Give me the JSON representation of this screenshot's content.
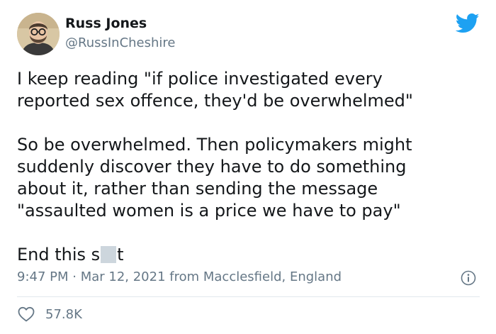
{
  "author": {
    "name": "Russ Jones",
    "handle": "@RussInCheshire",
    "avatar_icon": "profile-photo-man-glasses-beard"
  },
  "brand": {
    "icon": "twitter-bird-icon",
    "color": "#1da1f2"
  },
  "tweet": {
    "line1": "I keep reading \"if police investigated every",
    "line2": "reported sex offence, they'd be overwhelmed\"",
    "line3": "So be overwhelmed. Then policymakers might",
    "line4": "suddenly discover they have to do something",
    "line5": "about it, rather than sending the message",
    "line6": "\"assaulted women is a price we have to pay\"",
    "closing_prefix": "End this s",
    "closing_suffix": "t"
  },
  "meta": {
    "text": "9:47 PM · Mar 12, 2021 from Macclesfield, England",
    "info_icon": "info-icon"
  },
  "engagement": {
    "like_icon": "heart-icon",
    "likes": "57.8K"
  },
  "colors": {
    "text_primary": "#14171a",
    "text_secondary": "#657786",
    "divider": "#e1e8ed",
    "censor": "#cdd6dd"
  }
}
